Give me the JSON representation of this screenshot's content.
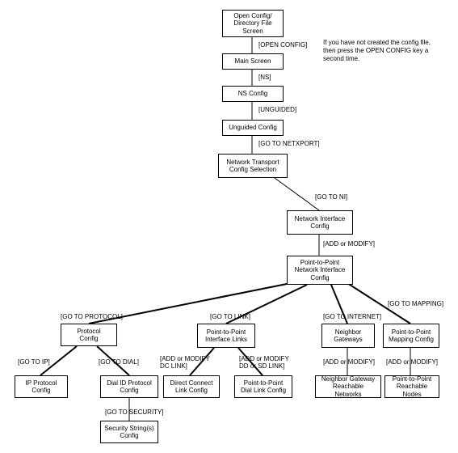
{
  "note": "If you have not created the config file, then press the OPEN CONFIG key a second time.",
  "boxes": {
    "open_config_dir": "Open Config/\nDirectory File\nScreen",
    "main_screen": "Main Screen",
    "ns_config": "NS Config",
    "unguided_config": "Unguided Config",
    "net_transport": "Network Transport\nConfig Selection",
    "net_interface": "Network Interface\nConfig",
    "ptp_net_interface": "Point-to-Point\nNetwork Interface\nConfig",
    "protocol_config": "Protocol\nConfig",
    "ptp_interface_links": "Point-to-Point\nInterface Links",
    "neighbor_gateways": "Neighbor\nGateways",
    "ptp_mapping_config": "Point-to-Point\nMapping Config",
    "ip_protocol": "IP Protocol\nConfig",
    "dial_id_protocol": "Dial ID Protocol\nConfig",
    "direct_connect": "Direct Connect\nLink Config",
    "ptp_dial_link": "Point-to-Point\nDial Link Config",
    "neighbor_gw_reach": "Neighbor Gateway\nReachable Networks",
    "ptp_reachable": "Point-to-Point\nReachable Nodes",
    "security_strings": "Security String(s)\nConfig"
  },
  "labels": {
    "open_config": "[OPEN CONFIG]",
    "ns": "[NS]",
    "unguided": "[UNGUIDED]",
    "go_netxport": "[GO TO NETXPORT]",
    "go_ni": "[GO TO NI]",
    "add_modify1": "[ADD or MODIFY]",
    "go_protocol": "[GO TO PROTOCOL]",
    "go_link": "[GO TO LINK]",
    "go_internet": "[GO TO INTERNET]",
    "go_mapping": "[GO TO MAPPING]",
    "go_ip": "[GO TO IP]",
    "go_dial": "[GO TO DIAL]",
    "add_mod_dc": "[ADD or MODIFY\nDC LINK]",
    "add_mod_dd": "[ADD or MODIFY\nDD or SD LINK]",
    "add_modify2": "[ADD or MODIFY]",
    "add_modify3": "[ADD or MODIFY]",
    "go_security": "[GO TO SECURITY]"
  }
}
